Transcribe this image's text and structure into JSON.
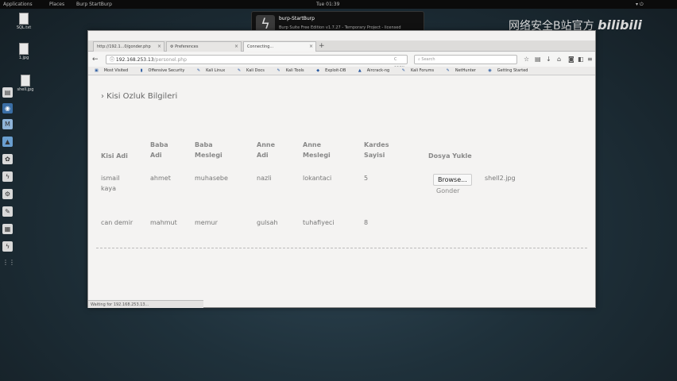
{
  "topbar": {
    "applications": "Applications",
    "places": "Places",
    "app_name": "Burp StartBurp",
    "clock": "Tue 01:39"
  },
  "desktop_icons": [
    {
      "label": "SQL.txt"
    },
    {
      "label": "1.jpg"
    },
    {
      "label": "shell.jpg"
    }
  ],
  "notification": {
    "title": "burp-StartBurp",
    "body": "Burp Suite Free Edition v1.7.27 - Temporary Project - licensed"
  },
  "watermark": {
    "text": "网络安全B站官方",
    "brand": "bilibili"
  },
  "browser": {
    "tabs": [
      {
        "label": "http://192.1...0/gonder.php"
      },
      {
        "label": "Preferences"
      },
      {
        "label": "Connecting..."
      }
    ],
    "new_tab": "+",
    "url_host": "192.168.253.13",
    "url_path": "/personel.php",
    "zoom": "C  150%",
    "search_placeholder": "Search",
    "bookmarks": [
      "Most Visited",
      "Offensive Security",
      "Kali Linux",
      "Kali Docs",
      "Kali Tools",
      "Exploit-DB",
      "Aircrack-ng",
      "Kali Forums",
      "NetHunter",
      "Getting Started"
    ],
    "status_text": "Waiting for 192.168.253.13..."
  },
  "page": {
    "heading": "› Kisi Ozluk Bilgileri",
    "headers": {
      "kisi_adi": "Kisi Adi",
      "baba_adi_1": "Baba",
      "baba_adi_2": "Adi",
      "baba_meslegi_1": "Baba",
      "baba_meslegi_2": "Meslegi",
      "anne_adi_1": "Anne",
      "anne_adi_2": "Adi",
      "anne_meslegi_1": "Anne",
      "anne_meslegi_2": "Meslegi",
      "kardes_1": "Kardes",
      "kardes_2": "Sayisi",
      "dosya": "Dosya Yukle"
    },
    "rows": [
      {
        "kisi_1": "ismail",
        "kisi_2": "kaya",
        "baba_adi": "ahmet",
        "baba_meslegi": "muhasebe",
        "anne_adi": "nazli",
        "anne_meslegi": "lokantaci",
        "kardes": "5",
        "browse": "Browse...",
        "file": "shell2.jpg",
        "gonder": "Gonder"
      },
      {
        "kisi_1": "can demir",
        "baba_adi": "mahmut",
        "baba_meslegi": "memur",
        "anne_adi": "gulsah",
        "anne_meslegi": "tuhafiyeci",
        "kardes": "8"
      }
    ]
  }
}
